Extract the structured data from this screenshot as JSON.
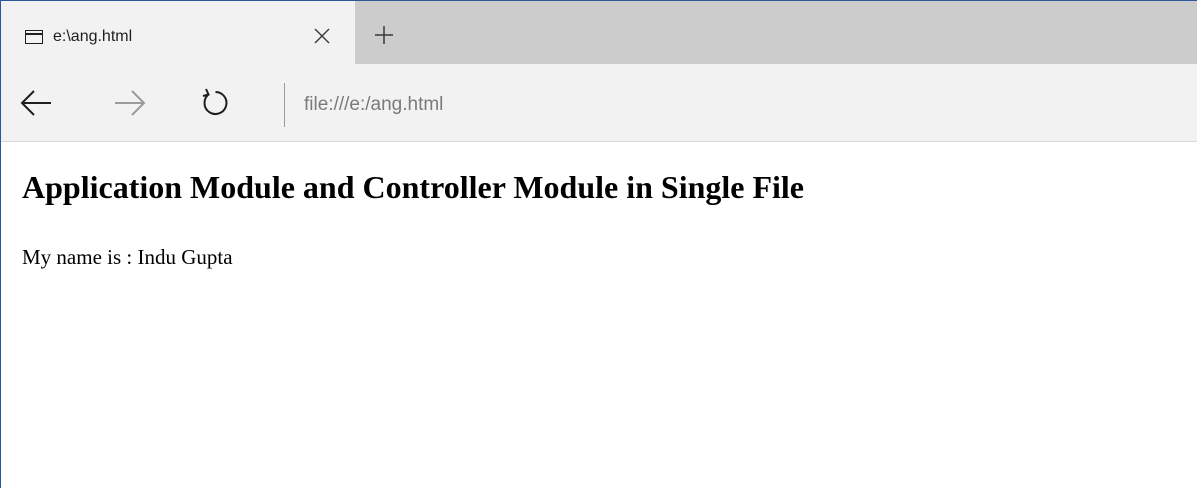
{
  "browser": {
    "tab": {
      "title": "e:\\ang.html",
      "icon": "page-icon",
      "close_icon": "close-icon"
    },
    "new_tab_icon": "plus-icon",
    "toolbar": {
      "back_icon": "back-arrow-icon",
      "forward_icon": "forward-arrow-icon",
      "refresh_icon": "refresh-icon",
      "address": "file:///e:/ang.html"
    },
    "colors": {
      "tabstrip": "#cccccc",
      "active_tab": "#f2f2f2",
      "toolbar": "#f2f2f2",
      "window_border": "#2b579a"
    }
  },
  "page": {
    "heading": "Application Module and Controller Module in Single File",
    "text": "My name is : Indu Gupta"
  }
}
